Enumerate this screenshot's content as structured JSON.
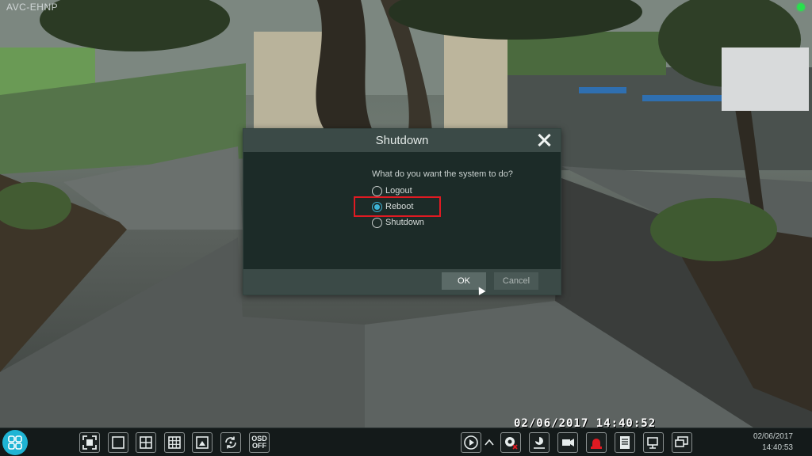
{
  "camera": {
    "title": "AVC-EHNP",
    "overlay_timestamp": "02/06/2017  14:40:52"
  },
  "dialog": {
    "title": "Shutdown",
    "question": "What do you want the system to do?",
    "options": [
      {
        "label": "Logout",
        "selected": false
      },
      {
        "label": "Reboot",
        "selected": true
      },
      {
        "label": "Shutdown",
        "selected": false
      }
    ],
    "ok_label": "OK",
    "cancel_label": "Cancel"
  },
  "taskbar": {
    "osd_label_top": "OSD",
    "osd_label_bottom": "OFF",
    "date": "02/06/2017",
    "time": "14:40:53"
  },
  "colors": {
    "accent": "#1fb4d4",
    "highlight": "#e01a22",
    "status_dot": "#29e04d"
  }
}
